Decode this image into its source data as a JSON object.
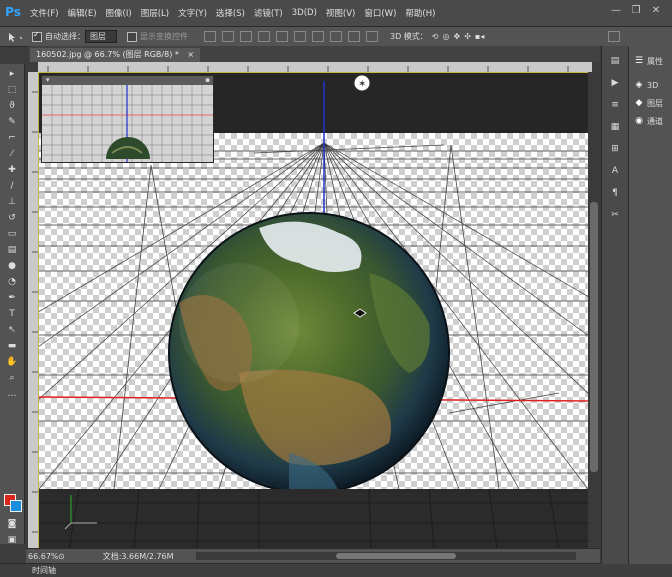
{
  "app": {
    "logo": "Ps"
  },
  "menu": [
    "文件(F)",
    "编辑(E)",
    "图像(I)",
    "图层(L)",
    "文字(Y)",
    "选择(S)",
    "滤镜(T)",
    "3D(D)",
    "视图(V)",
    "窗口(W)",
    "帮助(H)"
  ],
  "window_controls": {
    "minimize": "—",
    "restore": "❐",
    "close": "✕"
  },
  "options": {
    "auto_select_label": "自动选择：",
    "auto_select_checked": true,
    "auto_select_value": "图层",
    "show_transform_label": "显示变换控件",
    "show_transform_checked": false,
    "mode_3d_label": "3D 模式："
  },
  "document": {
    "tab_label": "160502.jpg @ 66.7% (图层 RGB/8) *",
    "tab_close": "×"
  },
  "status": {
    "zoom": "66.67%",
    "doc_info": "文档:3.66M/2.76M"
  },
  "timeline": {
    "label": "时间轴"
  },
  "panels": [
    {
      "icon": "properties-icon",
      "label": "属性"
    },
    {
      "icon": "3d-icon",
      "label": "3D"
    },
    {
      "icon": "layers-icon",
      "label": "图层"
    },
    {
      "icon": "channels-icon",
      "label": "通道"
    }
  ],
  "colors": {
    "foreground": "#d9261c",
    "background": "#1a8fe0",
    "x_axis": "#e02020",
    "z_axis": "#2030d0",
    "canvas_frame": "#c5b74a"
  }
}
